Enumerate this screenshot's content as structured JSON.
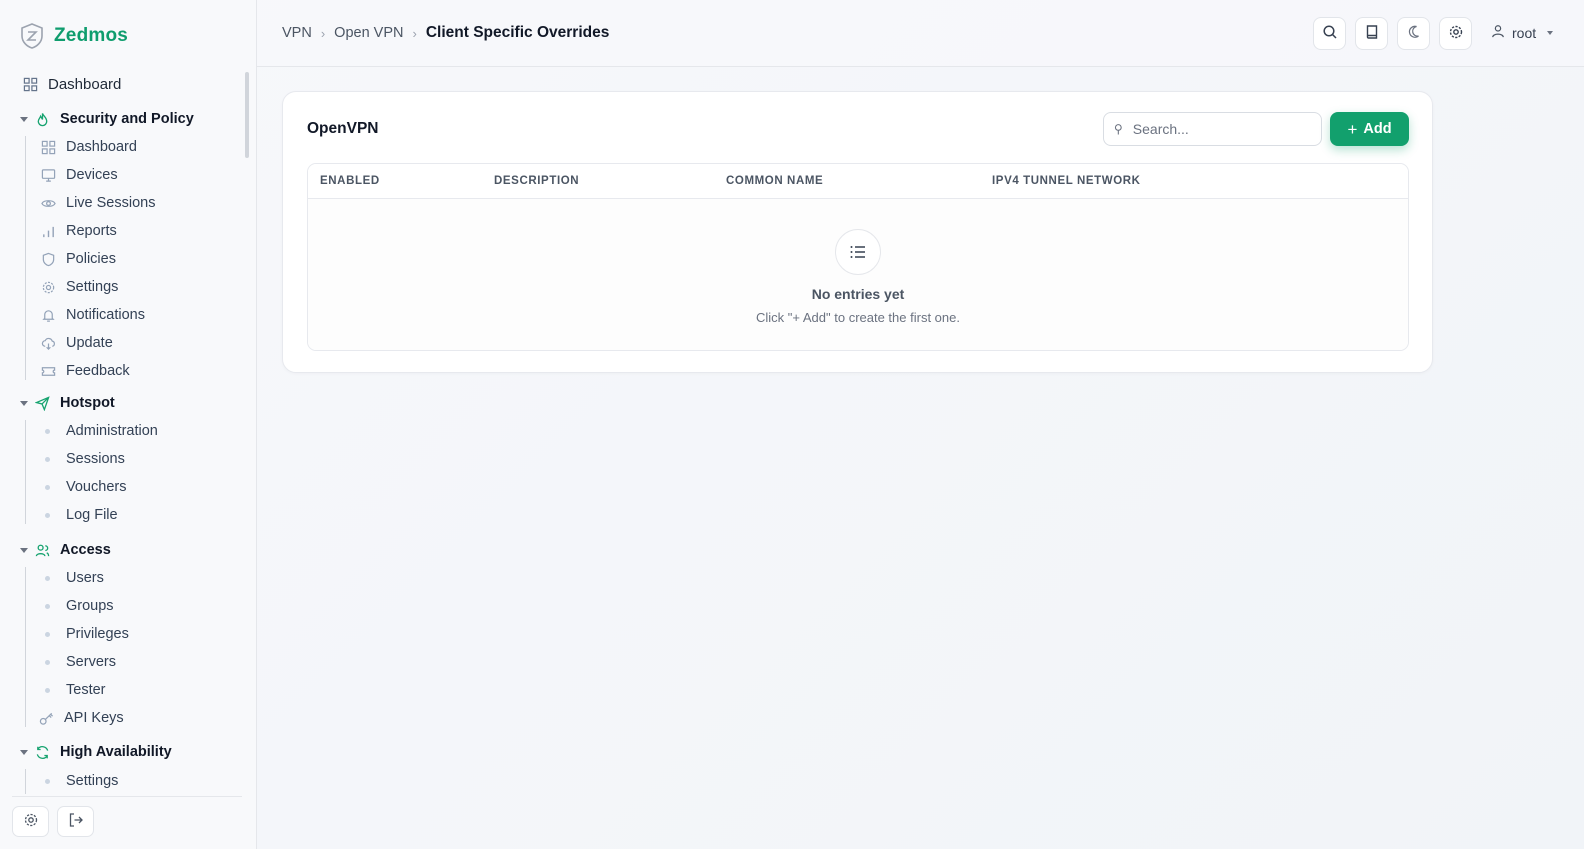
{
  "brand": {
    "name": "Zedmos"
  },
  "sidebar": {
    "top": {
      "label": "Dashboard",
      "icon": "grid-icon"
    },
    "groups": [
      {
        "label": "Security and Policy",
        "icon": "flame-icon",
        "items": [
          {
            "label": "Dashboard",
            "icon": "grid-icon"
          },
          {
            "label": "Devices",
            "icon": "monitor-icon"
          },
          {
            "label": "Live Sessions",
            "icon": "eye-icon"
          },
          {
            "label": "Reports",
            "icon": "bar-chart-icon"
          },
          {
            "label": "Policies",
            "icon": "shield-icon"
          },
          {
            "label": "Settings",
            "icon": "gear-icon"
          },
          {
            "label": "Notifications",
            "icon": "bell-icon"
          },
          {
            "label": "Update",
            "icon": "cloud-download-icon"
          },
          {
            "label": "Feedback",
            "icon": "ticket-icon"
          }
        ]
      },
      {
        "label": "Hotspot",
        "icon": "send-icon",
        "items": [
          {
            "label": "Administration"
          },
          {
            "label": "Sessions"
          },
          {
            "label": "Vouchers"
          },
          {
            "label": "Log File"
          }
        ]
      },
      {
        "label": "Access",
        "icon": "users-icon",
        "items": [
          {
            "label": "Users"
          },
          {
            "label": "Groups"
          },
          {
            "label": "Privileges"
          },
          {
            "label": "Servers"
          },
          {
            "label": "Tester"
          },
          {
            "label": "API Keys",
            "icon": "key-icon"
          }
        ]
      },
      {
        "label": "High Availability",
        "icon": "refresh-icon",
        "items": [
          {
            "label": "Settings"
          }
        ]
      }
    ]
  },
  "header": {
    "breadcrumb": [
      "VPN",
      "Open VPN",
      "Client Specific Overrides"
    ],
    "user": "root"
  },
  "card": {
    "title": "OpenVPN",
    "search_placeholder": "Search...",
    "add_label": "Add",
    "columns": [
      "ENABLED",
      "DESCRIPTION",
      "COMMON NAME",
      "IPV4 TUNNEL NETWORK"
    ],
    "empty_title": "No entries yet",
    "empty_subtitle": "Click \"+ Add\" to create the first one."
  },
  "colors": {
    "accent": "#12a06d",
    "brand": "#0f9d6e"
  }
}
